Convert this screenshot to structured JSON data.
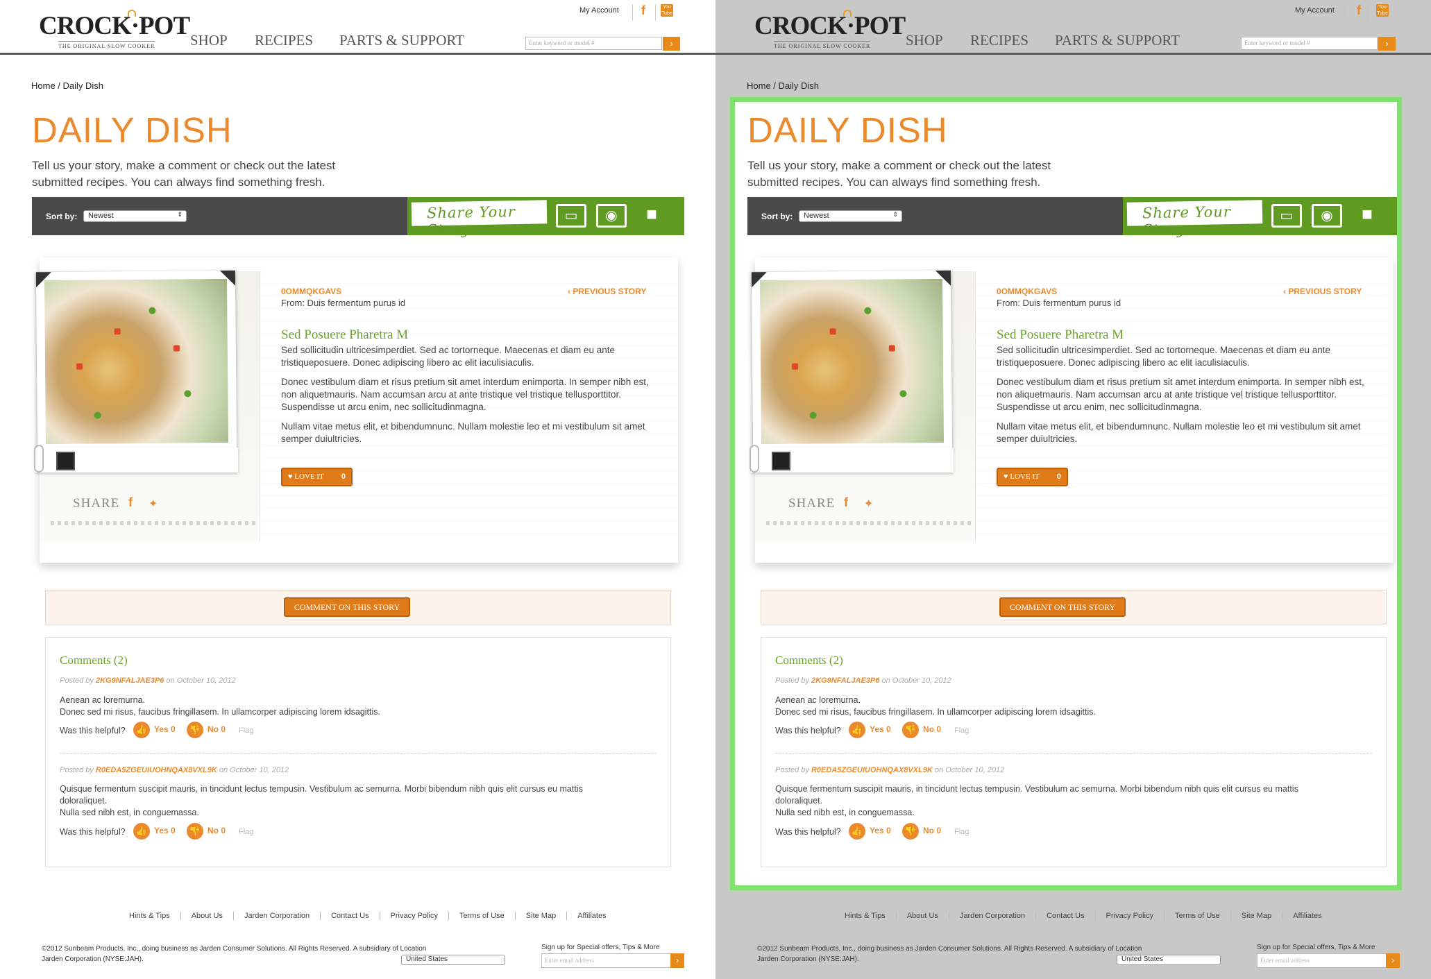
{
  "header": {
    "logo_text": "CROCK·POT",
    "logo_sub": "THE ORIGINAL SLOW COOKER",
    "nav": [
      "SHOP",
      "RECIPES",
      "PARTS & SUPPORT"
    ],
    "my_account": "My Account",
    "search_placeholder": "Enter keyword or model #",
    "facebook_icon": "facebook-icon",
    "youtube_icon": "youtube-icon",
    "youtube_text": "You Tube"
  },
  "breadcrumb": "Home / Daily Dish",
  "title": "DAILY DISH",
  "intro": "Tell us your story, make a comment or check out the latest submitted recipes. You can always find something fresh.",
  "sort": {
    "label": "Sort by:",
    "value": "Newest"
  },
  "share_your_story": "Share Your Story",
  "story": {
    "author": "0OMMQKGAVS",
    "from": "From: Duis fermentum purus id",
    "previous": "‹ PREVIOUS STORY",
    "title": "Sed Posuere Pharetra M",
    "paragraphs": [
      "Sed sollicitudin ultricesimperdiet. Sed ac tortorneque. Maecenas et diam eu ante tristiqueposuere. Donec adipiscing libero ac elit iaculisiaculis.",
      "Donec vestibulum diam et risus pretium sit amet interdum enimporta. In semper nibh est, non aliquetmauris. Nam accumsan arcu at ante tristique vel tristique tellusporttitor. Suspendisse ut arcu enim, nec sollicitudinmagna.",
      "Nullam vitae metus elit, et bibendumnunc. Nullam molestie leo et mi vestibulum sit amet semper duiultricies."
    ],
    "love_label": "LOVE IT",
    "love_count": "0",
    "share_label": "SHARE"
  },
  "comment_button": "COMMENT ON THIS STORY",
  "comments": {
    "heading": "Comments (2)",
    "items": [
      {
        "posted_by": "Posted by",
        "user": "2KG9NFALJAE3P6",
        "date": "on October 10, 2012",
        "lines": [
          "Aenean ac loremurna.",
          "Donec sed mi risus, faucibus fringillasem. In ullamcorper adipiscing lorem idsagittis."
        ],
        "helpful": "Was this helpful?",
        "yes": "Yes 0",
        "no": "No 0",
        "flag": "Flag"
      },
      {
        "posted_by": "Posted by",
        "user": "R0EDA5ZGEUIUOHNQAX8VXL9K",
        "date": "on October 10, 2012",
        "lines": [
          "Quisque fermentum suscipit mauris, in tincidunt lectus tempusin. Vestibulum ac semurna. Morbi bibendum nibh quis elit cursus eu mattis doloraliquet.",
          "Nulla sed nibh est, in conguemassa."
        ],
        "helpful": "Was this helpful?",
        "yes": "Yes 0",
        "no": "No 0",
        "flag": "Flag"
      }
    ]
  },
  "footer": {
    "links": [
      "Hints & Tips",
      "About Us",
      "Jarden Corporation",
      "Contact Us",
      "Privacy Policy",
      "Terms of Use",
      "Site Map",
      "Affiliates"
    ],
    "copyright": "©2012 Sunbeam Products, Inc., doing business as Jarden Consumer Solutions. All Rights Reserved. A subsidiary of Location Jarden Corporation (NYSE:JAH).",
    "country": "United States",
    "signup": "Sign up for Special offers, Tips & More",
    "email_placeholder": "Enter email address"
  },
  "colors": {
    "accent": "#ea8a2d",
    "green": "#5f9a21",
    "highlight": "#7ce46a"
  }
}
